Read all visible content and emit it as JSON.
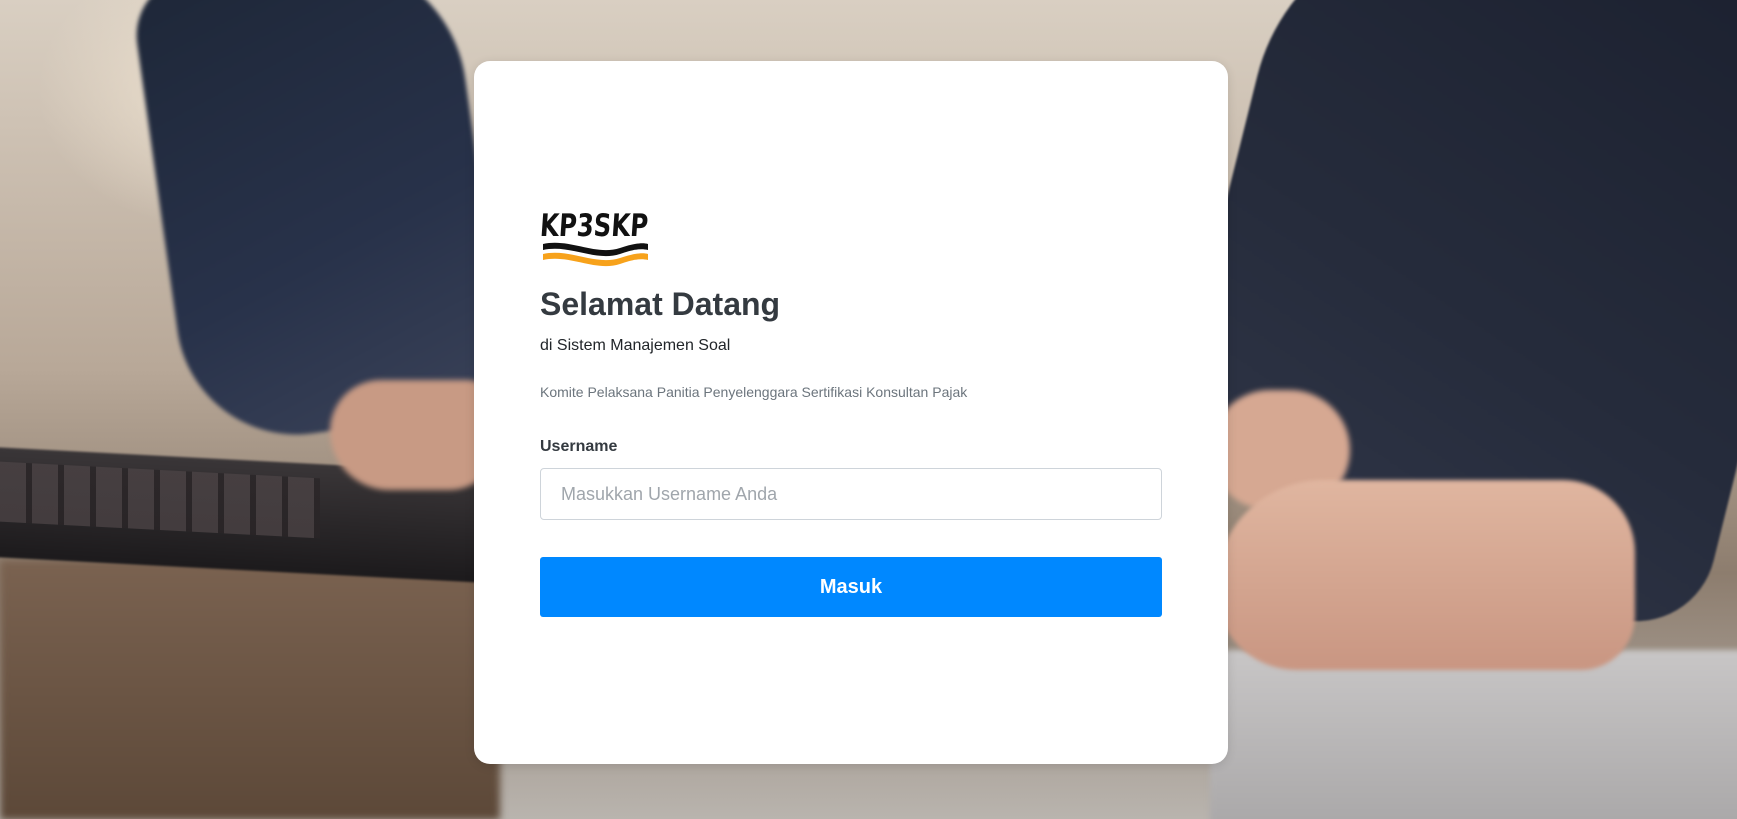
{
  "login": {
    "logo_text": "KP3SKP",
    "title": "Selamat Datang",
    "subtitle": "di Sistem Manajemen Soal",
    "organization": "Komite Pelaksana Panitia Penyelenggara Sertifikasi Konsultan Pajak",
    "username_label": "Username",
    "username_placeholder": "Masukkan Username Anda",
    "username_value": "",
    "submit_label": "Masuk"
  },
  "colors": {
    "primary_button": "#0088ff",
    "card_background": "#ffffff",
    "title_text": "#343a40",
    "muted_text": "#6c757d",
    "logo_orange": "#f7a21b",
    "logo_black": "#111111"
  }
}
